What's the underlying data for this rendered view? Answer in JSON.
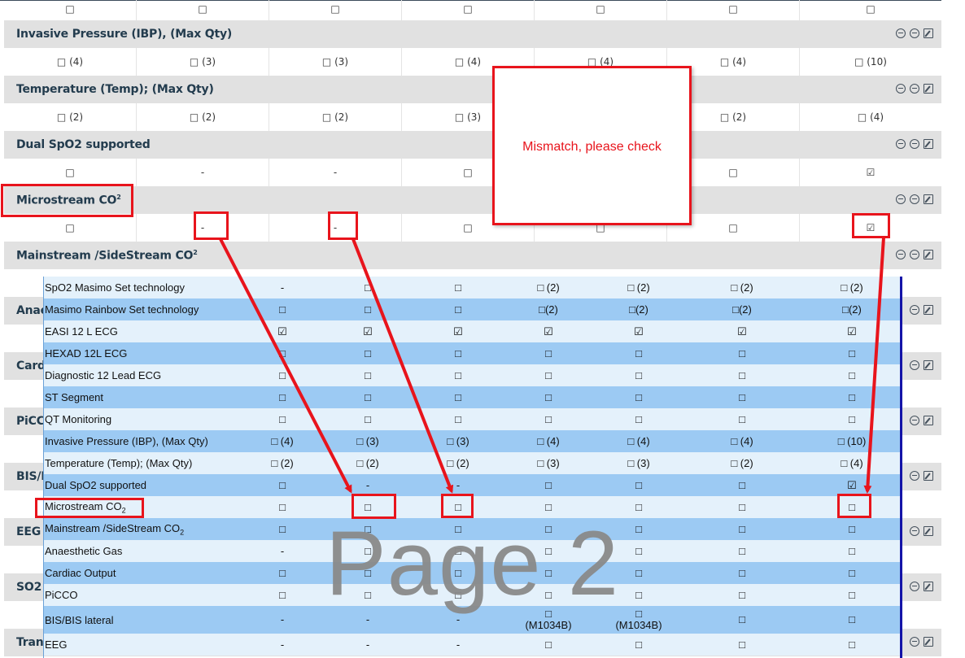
{
  "background_page": {
    "top_row_values": [
      "□",
      "□",
      "□",
      "□",
      "□",
      "□",
      "□"
    ],
    "sections": [
      {
        "title": "Invasive Pressure (IBP), (Max Qty)",
        "values": [
          "□ (4)",
          "□ (3)",
          "□ (3)",
          "□ (4)",
          "□ (4)",
          "□ (4)",
          "□ (10)"
        ]
      },
      {
        "title": "Temperature (Temp); (Max Qty)",
        "values": [
          "□ (2)",
          "□ (2)",
          "□ (2)",
          "□ (3)",
          "",
          "□ (2)",
          "□ (4)"
        ]
      },
      {
        "title": "Dual SpO2 supported",
        "values": [
          "□",
          "-",
          "-",
          "□",
          "",
          "□",
          "☑"
        ]
      },
      {
        "title": "Microstream CO",
        "superscript": "2",
        "values": [
          "□",
          "-",
          "-",
          "□",
          "□",
          "□",
          "☑"
        ]
      },
      {
        "title": "Mainstream /SideStream CO",
        "superscript": "2",
        "values": []
      }
    ],
    "cut_labels": [
      "Anae",
      "Cardi",
      "PiCC",
      "BIS/E",
      "EEG",
      "SO2",
      "Trans"
    ]
  },
  "callout": {
    "text": "Mismatch, please check"
  },
  "watermark": "Page 2",
  "page2_rows": [
    {
      "name": "SpO2 Masimo Set technology",
      "values": [
        "-",
        "□",
        "□",
        "□ (2)",
        "□ (2)",
        "□ (2)",
        "□ (2)"
      ]
    },
    {
      "name": "Masimo Rainbow Set technology",
      "values": [
        "□",
        "□",
        "□",
        "□(2)",
        "□(2)",
        "□(2)",
        "□(2)"
      ]
    },
    {
      "name": "EASI 12 L ECG",
      "values": [
        "☑",
        "☑",
        "☑",
        "☑",
        "☑",
        "☑",
        "☑"
      ]
    },
    {
      "name": "HEXAD 12L ECG",
      "values": [
        "□",
        "□",
        "□",
        "□",
        "□",
        "□",
        "□"
      ]
    },
    {
      "name": "Diagnostic 12 Lead ECG",
      "values": [
        "□",
        "□",
        "□",
        "□",
        "□",
        "□",
        "□"
      ]
    },
    {
      "name": "ST Segment",
      "values": [
        "□",
        "□",
        "□",
        "□",
        "□",
        "□",
        "□"
      ]
    },
    {
      "name": "QT Monitoring",
      "values": [
        "□",
        "□",
        "□",
        "□",
        "□",
        "□",
        "□"
      ]
    },
    {
      "name": "Invasive Pressure (IBP), (Max Qty)",
      "values": [
        "□ (4)",
        "□ (3)",
        "□ (3)",
        "□ (4)",
        "□ (4)",
        "□ (4)",
        "□ (10)"
      ]
    },
    {
      "name": "Temperature (Temp); (Max Qty)",
      "values": [
        "□ (2)",
        "□ (2)",
        "□ (2)",
        "□ (3)",
        "□ (3)",
        "□ (2)",
        "□ (4)"
      ]
    },
    {
      "name": "Dual SpO2 supported",
      "values": [
        "□",
        "-",
        "-",
        "□",
        "□",
        "□",
        "☑"
      ]
    },
    {
      "name": "Microstream CO",
      "subscript": "2",
      "values": [
        "□",
        "□",
        "□",
        "□",
        "□",
        "□",
        "□"
      ]
    },
    {
      "name": "Mainstream /SideStream CO",
      "subscript": "2",
      "values": [
        "□",
        "□",
        "□",
        "□",
        "□",
        "□",
        "□"
      ]
    },
    {
      "name": "Anaesthetic Gas",
      "values": [
        "-",
        "□",
        "□",
        "□",
        "□",
        "□",
        "□"
      ]
    },
    {
      "name": "Cardiac Output",
      "values": [
        "□",
        "□",
        "□",
        "□",
        "□",
        "□",
        "□"
      ]
    },
    {
      "name": "PiCCO",
      "values": [
        "□",
        "□",
        "□",
        "□",
        "□",
        "□",
        "□"
      ]
    },
    {
      "name": "BIS/BIS lateral",
      "values": [
        "-",
        "-",
        "-",
        "□\n(M1034B)",
        "□\n(M1034B)",
        "□",
        "□"
      ]
    },
    {
      "name": "EEG",
      "values": [
        "-",
        "-",
        "-",
        "□",
        "□",
        "□",
        "□"
      ]
    }
  ],
  "colors": {
    "annotation_red": "#e8141c",
    "row_dark": "#9ccaf3",
    "row_light": "#e4f1fb",
    "section_gray": "#e1e1e1"
  }
}
